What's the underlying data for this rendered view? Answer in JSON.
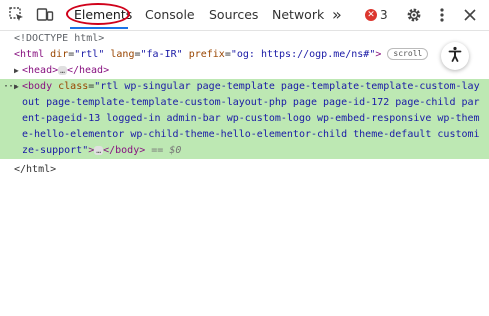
{
  "toolbar": {
    "tabs": [
      {
        "label": "Elements"
      },
      {
        "label": "Console"
      },
      {
        "label": "Sources"
      },
      {
        "label": "Network"
      }
    ],
    "more_tabs_label": "»",
    "error_count": "3",
    "icons": [
      "inspect-element-icon",
      "device-toggle-icon",
      "error-icon",
      "settings-gear-icon",
      "more-vert-icon",
      "close-icon"
    ]
  },
  "dom": {
    "doctype": "<!DOCTYPE html>",
    "html_open": {
      "tag": "html",
      "attrs": [
        {
          "name": "dir",
          "value": "\"rtl\""
        },
        {
          "name": "lang",
          "value": "\"fa-IR\""
        },
        {
          "name": "prefix",
          "value": "\"og: https://ogp.me/ns#\""
        }
      ],
      "badge": "scroll"
    },
    "head_line": {
      "open": "<head>",
      "ellipsis": "…",
      "close": "</head>"
    },
    "body_line": {
      "open": "<body",
      "class_attr": "class",
      "class_value": "\"rtl wp-singular page-template page-template-template-custom-layout page-template-template-custom-layout-php page page-id-172 page-child parent-pageid-13 logged-in admin-bar wp-custom-logo wp-embed-responsive wp-theme-hello-elementor wp-child-theme-hello-elementor-child theme-default customize-support\"",
      "close_open": ">",
      "ellipsis": "…",
      "close": "</body>",
      "eq": "== $0"
    },
    "html_close": "</html>",
    "row_menu": "···"
  },
  "colors": {
    "selected_row": "#bde8b3",
    "active_tab_underline": "#1a73e8",
    "highlight_ring": "#d0021b",
    "error_badge": "#dc362e"
  }
}
